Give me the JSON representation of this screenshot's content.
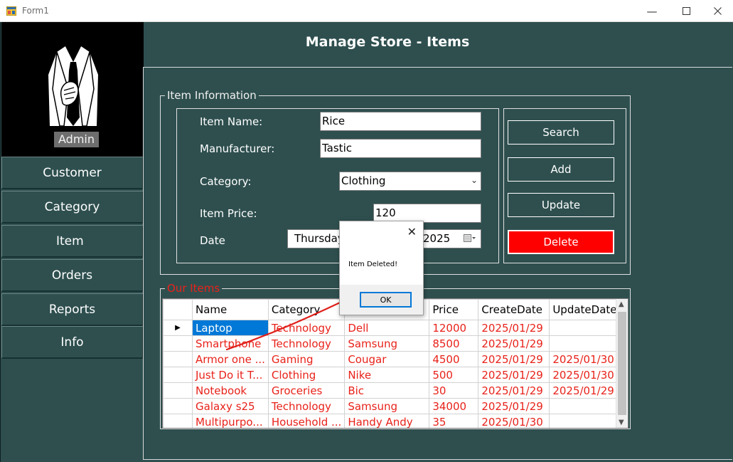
{
  "window": {
    "title": "Form1"
  },
  "sidebar": {
    "profile_label": "Admin",
    "items": [
      {
        "label": "Customer"
      },
      {
        "label": "Category"
      },
      {
        "label": "Item"
      },
      {
        "label": "Orders"
      },
      {
        "label": "Reports"
      },
      {
        "label": "Info"
      }
    ]
  },
  "header": {
    "title": "Manage Store - Items"
  },
  "item_info": {
    "legend": "Item Information",
    "item_name_label": "Item Name:",
    "item_name_value": "Rice",
    "manufacturer_label": "Manufacturer:",
    "manufacturer_value": "Tastic",
    "category_label": "Category:",
    "category_value": "Clothing",
    "price_label": "Item Price:",
    "price_value": "120",
    "date_label": "Date",
    "date_value_left": "Thursday",
    "date_value_right": "2025"
  },
  "actions": {
    "search": "Search",
    "add": "Add",
    "update": "Update",
    "delete": "Delete"
  },
  "items_grid": {
    "legend": "Our Items",
    "columns": [
      "Name",
      "Category",
      "",
      "Price",
      "CreateDate",
      "UpdateDate"
    ],
    "rows": [
      [
        "Laptop",
        "Technology",
        "Dell",
        "12000",
        "2025/01/29",
        ""
      ],
      [
        "Smartphone",
        "Technology",
        "Samsung",
        "8500",
        "2025/01/29",
        ""
      ],
      [
        "Armor one ...",
        "Gaming",
        "Cougar",
        "4500",
        "2025/01/29",
        "2025/01/30"
      ],
      [
        "Just Do it T...",
        "Clothing",
        "Nike",
        "500",
        "2025/01/29",
        "2025/01/30"
      ],
      [
        "Notebook",
        "Groceries",
        "Bic",
        "30",
        "2025/01/29",
        "2025/01/29"
      ],
      [
        "Galaxy s25",
        "Technology",
        "Samsung",
        "34000",
        "2025/01/29",
        ""
      ],
      [
        "Multipurpo...",
        "Household ...",
        "Handy Andy",
        "35",
        "2025/01/30",
        ""
      ]
    ]
  },
  "message_box": {
    "text": "Item Deleted!",
    "ok_label": "OK"
  },
  "colors": {
    "background": "#2f4f4f",
    "delete_button": "#ff0000",
    "grid_text": "#e8221a",
    "selection": "#0078d7",
    "annotation_arrow": "#e0201a"
  }
}
